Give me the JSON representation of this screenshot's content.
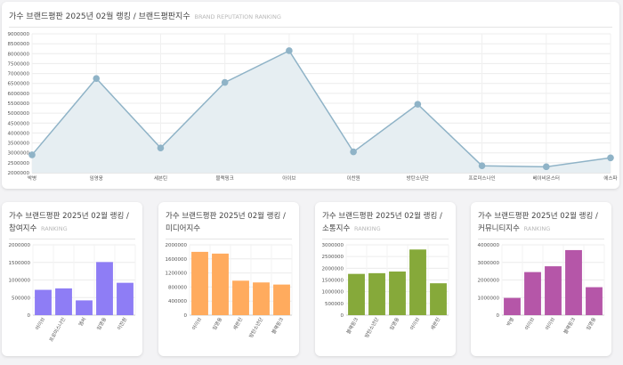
{
  "main": {
    "title": "가수 브랜드평판 2025년 02월 랭킹 / 브랜드평판지수",
    "subtitle": "BRAND REPUTATION RANKING"
  },
  "cards": [
    {
      "title": "가수 브랜드평판 2025년 02월 랭킹 / 참여지수",
      "subtitle": "RANKING"
    },
    {
      "title": "가수 브랜드평판 2025년 02월 랭킹 / 미디어지수",
      "subtitle": ""
    },
    {
      "title": "가수 브랜드평판 2025년 02월 랭킹 / 소통지수",
      "subtitle": "RANKING"
    },
    {
      "title": "가수 브랜드평판 2025년 02월 랭킹 / 커뮤니티지수",
      "subtitle": "RANKING"
    }
  ],
  "chart_data": [
    {
      "type": "area",
      "categories": [
        "박병",
        "임영웅",
        "세븐틴",
        "블랙핑크",
        "아이브",
        "이찬원",
        "방탄소년단",
        "프로미스나인",
        "베이비몬스터",
        "에스파"
      ],
      "values": [
        2900000,
        6750000,
        3250000,
        6550000,
        8150000,
        3050000,
        5450000,
        2350000,
        2300000,
        2750000
      ],
      "ylim": [
        2000000,
        9000000
      ],
      "yticks": [
        "9000000",
        "8500000",
        "8000000",
        "7500000",
        "7000000",
        "6500000",
        "6000000",
        "5500000",
        "5000000",
        "4500000",
        "4000000",
        "3500000",
        "3000000",
        "2500000",
        "2000000"
      ],
      "line_color": "#8fb3c7",
      "fill_color": "#e6eef2",
      "grid": true
    },
    {
      "type": "bar",
      "categories": [
        "아이브",
        "프로미스나인",
        "엠씨",
        "임영웅",
        "이찬원"
      ],
      "values": [
        720000,
        760000,
        420000,
        1510000,
        920000
      ],
      "ylim": [
        0,
        2000000
      ],
      "yticks": [
        "2000000",
        "1500000",
        "1000000",
        "500000",
        "0"
      ],
      "color": "#8e7df5",
      "grid": true
    },
    {
      "type": "bar",
      "categories": [
        "아이브",
        "임영웅",
        "세븐틴",
        "방탄소년단",
        "블랙핑크"
      ],
      "values": [
        1800000,
        1750000,
        980000,
        930000,
        870000
      ],
      "ylim": [
        0,
        2000000
      ],
      "yticks": [
        "2000000",
        "1600000",
        "1200000",
        "800000",
        "400000",
        "0"
      ],
      "color": "#ffab5e",
      "grid": true
    },
    {
      "type": "bar",
      "categories": [
        "블랙핑크",
        "방탄소년단",
        "임영웅",
        "아이브",
        "세븐틴"
      ],
      "values": [
        1760000,
        1790000,
        1860000,
        2800000,
        1360000
      ],
      "ylim": [
        0,
        3000000
      ],
      "yticks": [
        "3000000",
        "2500000",
        "2000000",
        "1500000",
        "1000000",
        "500000",
        "0"
      ],
      "color": "#86a93a",
      "grid": true
    },
    {
      "type": "bar",
      "categories": [
        "박병",
        "아이브",
        "아이브",
        "블랙핑크",
        "임영웅"
      ],
      "values": [
        980000,
        2450000,
        2780000,
        3700000,
        1590000
      ],
      "ylim": [
        0,
        4000000
      ],
      "yticks": [
        "4000000",
        "3000000",
        "2000000",
        "1000000",
        "0"
      ],
      "color": "#b556a8",
      "grid": true
    }
  ]
}
